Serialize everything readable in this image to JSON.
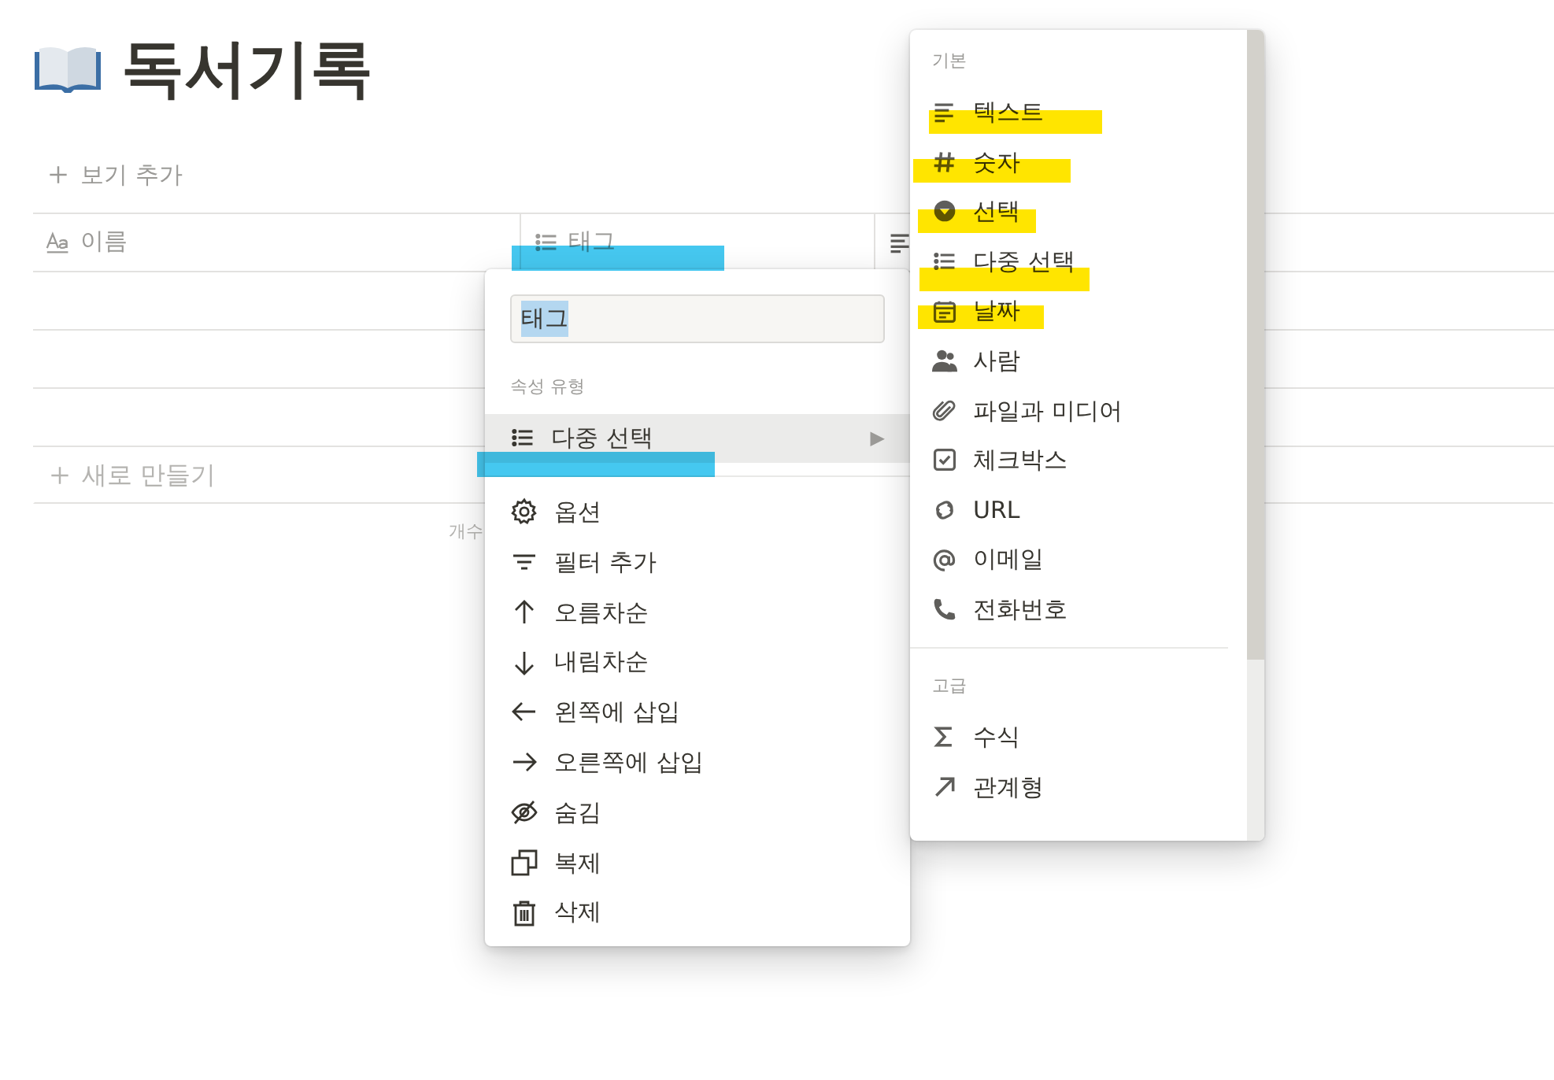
{
  "page": {
    "title": "독서기록",
    "add_view": "보기 추가"
  },
  "table": {
    "columns": [
      {
        "label": "이름",
        "highlighted": false
      },
      {
        "label": "태그",
        "highlighted": true
      }
    ],
    "new_row": "새로 만들기",
    "footer": "개수"
  },
  "property_menu": {
    "name_field": {
      "value": "태그",
      "text_selected": true
    },
    "section_label": "속성 유형",
    "current_type": {
      "label": "다중 선택",
      "arrow": "▶",
      "selected": true,
      "highlighted": true
    },
    "items": [
      "옵션",
      "필터 추가",
      "오름차순",
      "내림차순",
      "왼쪽에 삽입",
      "오른쪽에 삽입",
      "숨김",
      "복제",
      "삭제"
    ]
  },
  "type_menu": {
    "sections": [
      {
        "label": "기본",
        "items": [
          {
            "label": "텍스트",
            "highlighted": true
          },
          {
            "label": "숫자",
            "highlighted": true
          },
          {
            "label": "선택",
            "highlighted": true
          },
          {
            "label": "다중 선택",
            "highlighted": true
          },
          {
            "label": "날짜",
            "highlighted": true
          },
          {
            "label": "사람",
            "highlighted": false
          },
          {
            "label": "파일과 미디어",
            "highlighted": false
          },
          {
            "label": "체크박스",
            "highlighted": false
          },
          {
            "label": "URL",
            "highlighted": false
          },
          {
            "label": "이메일",
            "highlighted": false
          },
          {
            "label": "전화번호",
            "highlighted": false
          }
        ]
      },
      {
        "label": "고급",
        "items": [
          {
            "label": "수식",
            "highlighted": false
          },
          {
            "label": "관계형",
            "highlighted": false
          }
        ]
      }
    ]
  }
}
